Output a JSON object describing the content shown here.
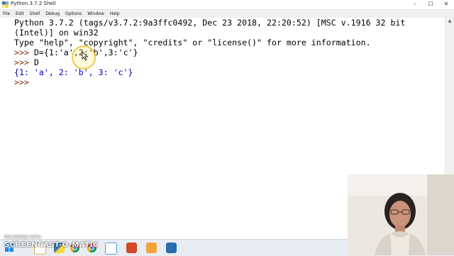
{
  "window": {
    "title": "Python 3.7.2 Shell",
    "controls": {
      "minimize": "–",
      "maximize": "☐",
      "close": "✕"
    }
  },
  "menu": {
    "items": [
      "File",
      "Edit",
      "Shell",
      "Debug",
      "Options",
      "Window",
      "Help"
    ]
  },
  "shell": {
    "banner_1": "Python 3.7.2 (tags/v3.7.2:9a3ffc0492, Dec 23 2018, 22:20:52) [MSC v.1916 32 bit",
    "banner_2": "(Intel)] on win32",
    "banner_3": "Type \"help\", \"copyright\", \"credits\" or \"license()\" for more information.",
    "prompt": ">>>",
    "cmd1_code": " D={1:'a',2:'b',3:'c'}",
    "cmd2_code": " D",
    "output": "{1: 'a', 2: 'b', 3: 'c'}"
  },
  "watermark": {
    "small": "RECORDED WITH",
    "large": "SCREENCAST-O-MATIC"
  },
  "colors": {
    "prompt": "#7a2a00",
    "output": "#0000c0",
    "highlight": "#f2c94c"
  },
  "taskbar": {
    "icons": [
      "start-icon",
      "file-explorer-icon",
      "python-idle-icon",
      "chrome-icon",
      "chrome-icon-2",
      "powerpoint-icon",
      "media-icon",
      "screencast-icon",
      "paint-icon"
    ]
  }
}
